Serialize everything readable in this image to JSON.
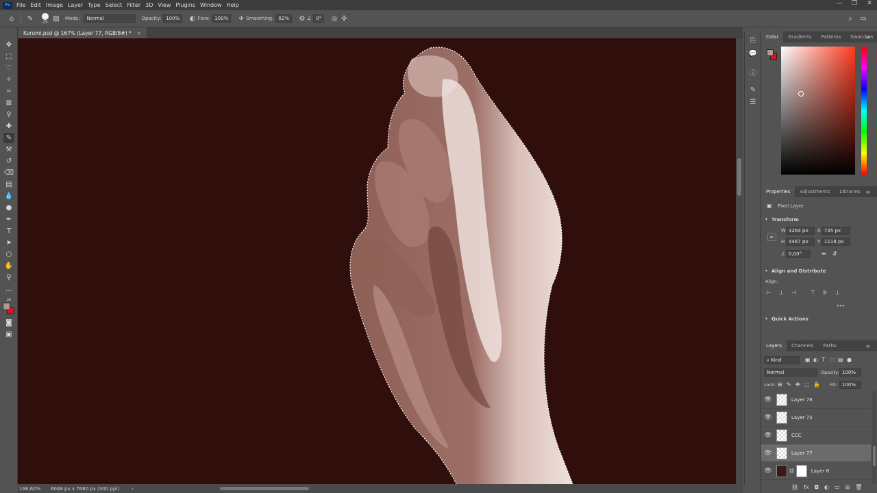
{
  "app": {
    "logo_text": "Ps",
    "menu": [
      "File",
      "Edit",
      "Image",
      "Layer",
      "Type",
      "Select",
      "Filter",
      "3D",
      "View",
      "Plugins",
      "Window",
      "Help"
    ],
    "window_controls": [
      "—",
      "❐",
      "✕"
    ]
  },
  "options_bar": {
    "brush_size": "25",
    "mode_label": "Mode:",
    "mode_value": "Normal",
    "opacity_label": "Opacity:",
    "opacity_value": "100%",
    "flow_label": "Flow:",
    "flow_value": "100%",
    "smoothing_label": "Smoothing:",
    "smoothing_value": "82%",
    "angle_value": "0°"
  },
  "document": {
    "tab_title": "Kurumi.psd @ 167% (Layer 77, RGB/8#) *",
    "close": "×",
    "zoom": "166,62%",
    "doc_info": "6048 px x 7680 px (300 ppi)",
    "status_arrow": "›",
    "canvas_bg": "#2f0e0c"
  },
  "color_panel": {
    "tabs": [
      "Color",
      "Gradients",
      "Patterns",
      "Swatches"
    ],
    "foreground": "#b09a98",
    "background": "#e0141e",
    "hue": "#ff3a1e"
  },
  "properties": {
    "tabs": [
      "Properties",
      "Adjustments",
      "Libraries"
    ],
    "layer_type": "Pixel Layer",
    "transform_title": "Transform",
    "w_label": "W",
    "w_value": "3264 px",
    "h_label": "H",
    "h_value": "4467 px",
    "x_label": "X",
    "x_value": "735 px",
    "y_label": "Y",
    "y_value": "1118 px",
    "angle_value": "0,00°",
    "align_title": "Align and Distribute",
    "align_label": "Align:",
    "more": "•••",
    "quick_actions": "Quick Actions"
  },
  "layers_panel": {
    "tabs": [
      "Layers",
      "Channels",
      "Paths"
    ],
    "filter_kind": "Kind",
    "blend_mode": "Normal",
    "opacity_label": "Opacity:",
    "opacity_value": "100%",
    "lock_label": "Lock:",
    "fill_label": "Fill:",
    "fill_value": "100%",
    "layers": [
      {
        "name": "Layer 76",
        "visible": true,
        "selected": false
      },
      {
        "name": "Layer 75",
        "visible": true,
        "selected": false
      },
      {
        "name": "CCC",
        "visible": true,
        "selected": false
      },
      {
        "name": "Layer 77",
        "visible": true,
        "selected": true
      },
      {
        "name": "Layer 8",
        "visible": true,
        "selected": false
      }
    ]
  }
}
